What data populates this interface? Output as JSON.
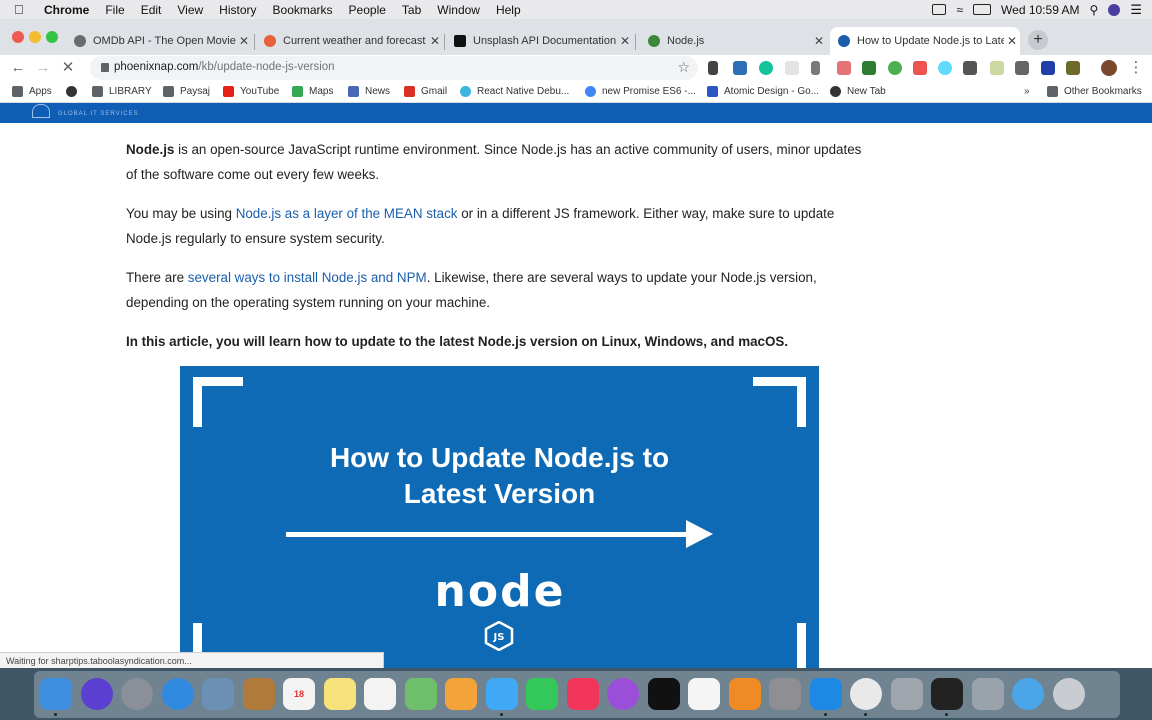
{
  "menubar": {
    "app": "Chrome",
    "items": [
      "File",
      "Edit",
      "View",
      "History",
      "Bookmarks",
      "People",
      "Tab",
      "Window",
      "Help"
    ],
    "clock": "Wed 10:59 AM"
  },
  "tabs": [
    {
      "title": "OMDb API - The Open Movie Da",
      "favicon_color": "#6b6b6b"
    },
    {
      "title": "Current weather and forecast - (",
      "favicon_color": "#e8613a"
    },
    {
      "title": "Unsplash API Documentation | F",
      "favicon_color": "#111111"
    },
    {
      "title": "Node.js",
      "favicon_color": "#3c873a"
    },
    {
      "title": "How to Update Node.js to Lates",
      "favicon_color": "#1b5eae",
      "active": true
    }
  ],
  "toolbar": {
    "url_host": "phoenixnap.com",
    "url_path": "/kb/update-node-js-version"
  },
  "bookmarks": {
    "items": [
      {
        "label": "Apps",
        "icon_color": "#5f6368"
      },
      {
        "label": "",
        "icon_color": "#333333"
      },
      {
        "label": "LIBRARY",
        "icon_color": "#5f6368"
      },
      {
        "label": "Paysaj",
        "icon_color": "#5f6368"
      },
      {
        "label": "YouTube",
        "icon_color": "#e62117"
      },
      {
        "label": "Maps",
        "icon_color": "#34a853"
      },
      {
        "label": "News",
        "icon_color": "#4a67b5"
      },
      {
        "label": "Gmail",
        "icon_color": "#d93025"
      },
      {
        "label": "React Native Debu...",
        "icon_color": "#3fb4e0"
      },
      {
        "label": "new Promise ES6 -...",
        "icon_color": "#4285f4"
      },
      {
        "label": "Atomic Design - Go...",
        "icon_color": "#2a56c6"
      },
      {
        "label": "New Tab",
        "icon_color": "#333333"
      }
    ],
    "overflow": "»",
    "other": "Other Bookmarks"
  },
  "site": {
    "logo_text": "GLOBAL IT SERVICES"
  },
  "article": {
    "p1_bold": "Node.js",
    "p1_rest": " is an open-source JavaScript runtime environment. Since Node.js has an active community of users, minor updates of the software come out every few weeks.",
    "p2_start": "You may be using ",
    "p2_link": "Node.js as a layer of the MEAN stack",
    "p2_end": " or in a different JS framework. Either way, make sure to update Node.js regularly to ensure system security.",
    "p3_start": "There are ",
    "p3_link": "several ways to install Node.js and NPM",
    "p3_end": ". Likewise, there are several ways to update your Node.js version, depending on the operating system running on your machine.",
    "p4": "In this article, you will learn how to update to the latest Node.js version on Linux, Windows, and macOS."
  },
  "hero": {
    "title_line1": "How to Update Node.js to",
    "title_line2": "Latest Version",
    "logo_word": "node",
    "logo_badge": "JS",
    "bg_color": "#0e6ab4"
  },
  "status": "Waiting for sharptips.taboolasyndication.com...",
  "dock": {
    "calendar_day": "18",
    "apps": [
      {
        "name": "finder",
        "color": "#3f8fe0"
      },
      {
        "name": "siri",
        "color": "#5a3fd0"
      },
      {
        "name": "launchpad",
        "color": "#8a8f98"
      },
      {
        "name": "safari",
        "color": "#2f8ae0"
      },
      {
        "name": "preview",
        "color": "#6b8fb5"
      },
      {
        "name": "notefile",
        "color": "#b07a3a"
      },
      {
        "name": "calendar",
        "color": "#f3f3f3"
      },
      {
        "name": "notes",
        "color": "#f5e27a"
      },
      {
        "name": "reminders",
        "color": "#f3f3f3"
      },
      {
        "name": "maps",
        "color": "#6fbf6a"
      },
      {
        "name": "photos",
        "color": "#f2a33a"
      },
      {
        "name": "messages-1",
        "color": "#3fa9f5"
      },
      {
        "name": "facetime",
        "color": "#34c759"
      },
      {
        "name": "music",
        "color": "#f2355b"
      },
      {
        "name": "podcasts",
        "color": "#9b4fd9"
      },
      {
        "name": "tv",
        "color": "#111111"
      },
      {
        "name": "news",
        "color": "#f5f5f5"
      },
      {
        "name": "books",
        "color": "#f08a24"
      },
      {
        "name": "system-preferences",
        "color": "#8e8e93"
      },
      {
        "name": "vscode",
        "color": "#1e88e5"
      },
      {
        "name": "chrome",
        "color": "#e9e9e9"
      },
      {
        "name": "photo-booth",
        "color": "#a0a4ad"
      },
      {
        "name": "terminal",
        "color": "#222222"
      },
      {
        "name": "archive",
        "color": "#9aa3ac"
      },
      {
        "name": "folder",
        "color": "#4aa6e8"
      },
      {
        "name": "trash",
        "color": "#c9ccd1"
      }
    ]
  }
}
